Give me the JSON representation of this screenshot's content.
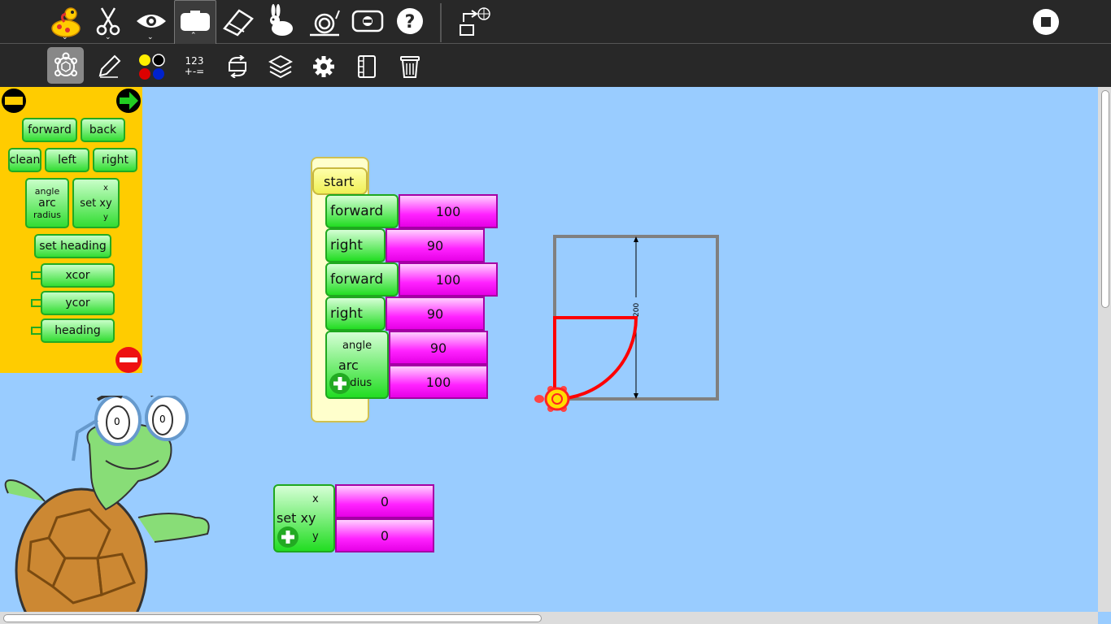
{
  "toolbar_main": {
    "items": [
      {
        "name": "project-menu",
        "icon": "turtle-logo-icon"
      },
      {
        "name": "cut",
        "icon": "scissors-icon"
      },
      {
        "name": "view",
        "icon": "eye-icon"
      },
      {
        "name": "blocks-palette",
        "icon": "palette-icon",
        "selected": true
      },
      {
        "name": "clean",
        "icon": "eraser-icon"
      },
      {
        "name": "run-fast",
        "icon": "rabbit-icon"
      },
      {
        "name": "run-slow",
        "icon": "snail-icon"
      },
      {
        "name": "step",
        "icon": "step-icon"
      },
      {
        "name": "help",
        "icon": "help-icon"
      },
      {
        "name": "share",
        "icon": "share-icon"
      },
      {
        "name": "stop",
        "icon": "stop-icon"
      }
    ]
  },
  "toolbar_palettes": {
    "number_label_top": "123",
    "number_label_bottom": "+-=",
    "items": [
      "turtle-palette-icon",
      "pen-icon",
      "color-palette-icon",
      "number-palette-icon",
      "flow-icon",
      "blocks-icon",
      "sensors-icon",
      "media-icon",
      "trash-icon"
    ]
  },
  "palette": {
    "blocks": {
      "forward": "forward",
      "back": "back",
      "clean": "clean",
      "left": "left",
      "right": "right",
      "arc": "arc",
      "arc_angle": "angle",
      "arc_radius": "radius",
      "setxy": "set xy",
      "setxy_x": "x",
      "setxy_y": "y",
      "set_heading": "set heading",
      "xcor": "xcor",
      "ycor": "ycor",
      "heading": "heading"
    }
  },
  "program": {
    "start_label": "start",
    "stack": [
      {
        "cmd": "forward",
        "value": "100"
      },
      {
        "cmd": "right",
        "value": "90"
      },
      {
        "cmd": "forward",
        "value": "100"
      },
      {
        "cmd": "right",
        "value": "90"
      }
    ],
    "arc": {
      "label": "arc",
      "angle_label": "angle",
      "radius_label": "radius",
      "angle": "90",
      "radius": "100"
    },
    "setxy": {
      "label": "set xy",
      "x_label": "x",
      "y_label": "y",
      "x": "0",
      "y": "0"
    }
  },
  "drawing": {
    "pen_color": "#ff0000",
    "box_color": "#808080",
    "dimension_label": "200"
  },
  "colors": {
    "toolbar_bg": "#282828",
    "canvas_bg": "#99ccff",
    "palette_bg": "#ffcc00"
  }
}
